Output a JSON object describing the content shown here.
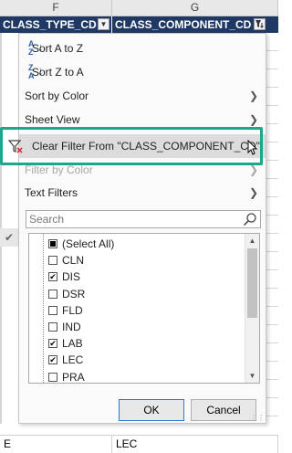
{
  "columns": {
    "f": "F",
    "g": "G"
  },
  "header_cells": {
    "f": "CLASS_TYPE_CD",
    "g": "CLASS_COMPONENT_CD"
  },
  "menu": {
    "sort_az": "Sort A to Z",
    "sort_za": "Sort Z to A",
    "sort_by_color": "Sort by Color",
    "sheet_view": "Sheet View",
    "clear_filter": "Clear Filter From \"CLASS_COMPONENT_CD\"",
    "filter_by_color": "Filter by Color",
    "text_filters": "Text Filters"
  },
  "search": {
    "placeholder": "Search"
  },
  "values": [
    {
      "label": "(Select All)",
      "state": "partial"
    },
    {
      "label": "CLN",
      "state": "unchecked"
    },
    {
      "label": "DIS",
      "state": "checked"
    },
    {
      "label": "DSR",
      "state": "unchecked"
    },
    {
      "label": "FLD",
      "state": "unchecked"
    },
    {
      "label": "IND",
      "state": "unchecked"
    },
    {
      "label": "LAB",
      "state": "checked"
    },
    {
      "label": "LEC",
      "state": "checked"
    },
    {
      "label": "PRA",
      "state": "unchecked"
    }
  ],
  "buttons": {
    "ok": "OK",
    "cancel": "Cancel"
  },
  "bottom_cells": {
    "f": "E",
    "g": "LEC"
  },
  "colors": {
    "header_bg": "#203864",
    "highlight_frame": "#1fa58a",
    "menu_bg": "#fafafa"
  }
}
